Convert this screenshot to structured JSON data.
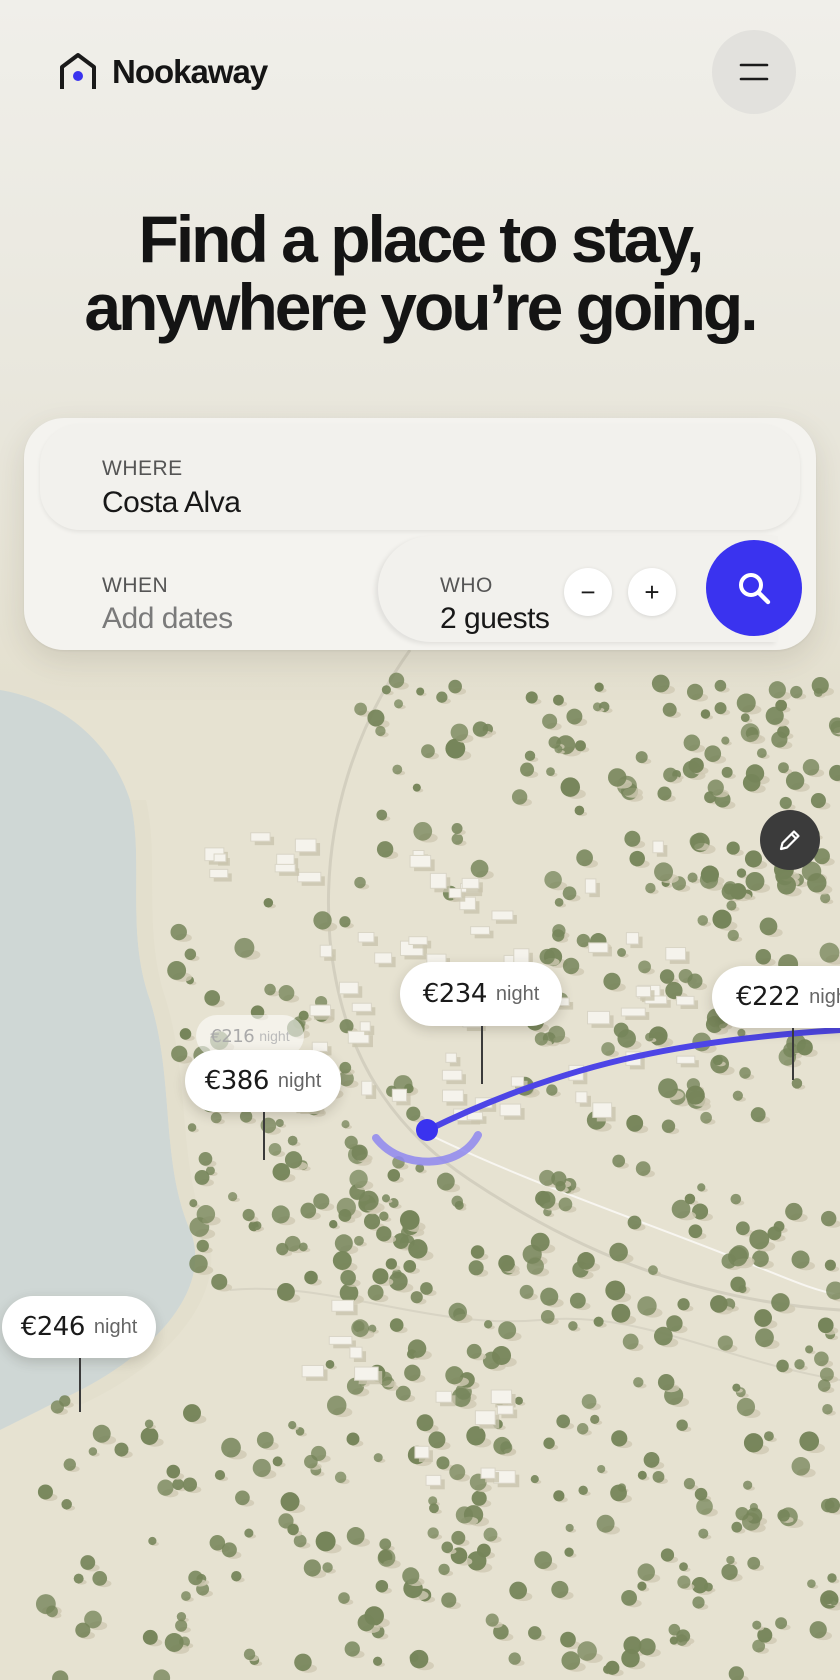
{
  "header": {
    "brand": "Nookaway",
    "logo_icon": "house-outline-icon",
    "menu_icon": "hamburger-menu-icon"
  },
  "hero": {
    "line1": "Find a place to stay,",
    "line2": "anywhere you’re going."
  },
  "search": {
    "where": {
      "label": "WHERE",
      "value": "Costa Alva"
    },
    "when": {
      "label": "WHEN",
      "placeholder": "Add dates"
    },
    "who": {
      "label": "WHO",
      "value": "2 guests",
      "decrement": "−",
      "increment": "+"
    },
    "submit_icon": "search-icon"
  },
  "map": {
    "edit_icon": "pencil-icon",
    "pins": [
      {
        "price": "€234",
        "unit": "night"
      },
      {
        "price": "€222",
        "unit": "night"
      },
      {
        "price": "€386",
        "unit": "night"
      },
      {
        "price": "€216",
        "unit": "night"
      },
      {
        "price": "€246",
        "unit": "night"
      }
    ]
  },
  "colors": {
    "accent": "#3a33ef",
    "route": "#4d45e6",
    "background": "#e7e3d3",
    "water": "#cfd7d5",
    "tree": "#76855a"
  }
}
